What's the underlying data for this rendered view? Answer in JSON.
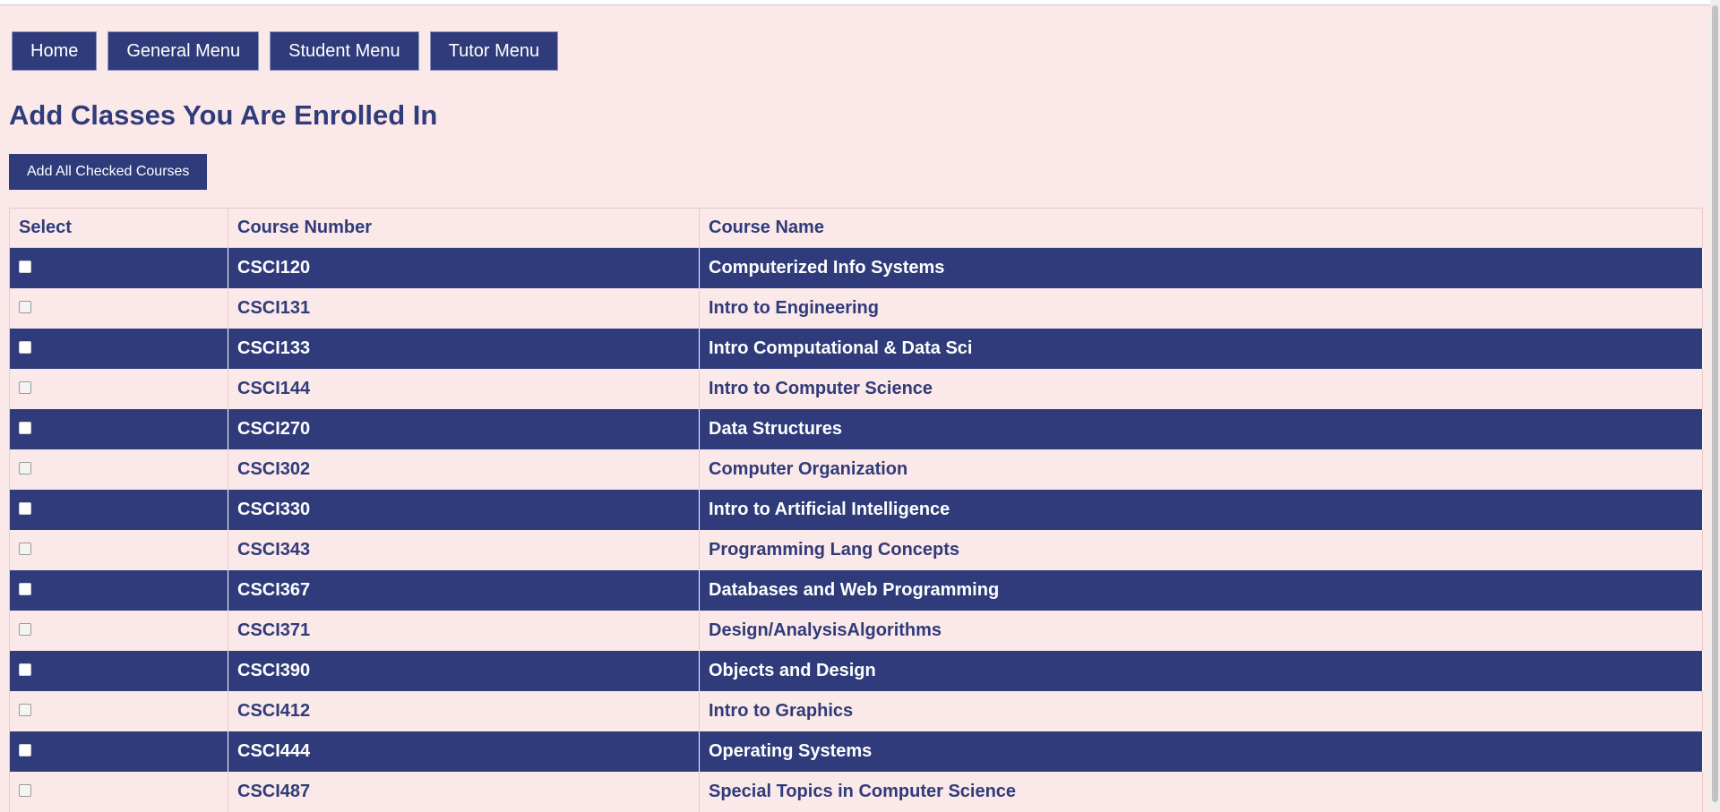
{
  "nav": [
    "Home",
    "General Menu",
    "Student Menu",
    "Tutor Menu"
  ],
  "page_title": "Add Classes You Are Enrolled In",
  "add_button": "Add All Checked Courses",
  "table": {
    "headers": [
      "Select",
      "Course Number",
      "Course Name"
    ],
    "rows": [
      {
        "number": "CSCI120",
        "name": "Computerized Info Systems",
        "checked": false
      },
      {
        "number": "CSCI131",
        "name": "Intro to Engineering",
        "checked": false
      },
      {
        "number": "CSCI133",
        "name": "Intro Computational & Data Sci",
        "checked": false
      },
      {
        "number": "CSCI144",
        "name": "Intro to Computer Science",
        "checked": false
      },
      {
        "number": "CSCI270",
        "name": "Data Structures",
        "checked": false
      },
      {
        "number": "CSCI302",
        "name": "Computer Organization",
        "checked": false
      },
      {
        "number": "CSCI330",
        "name": "Intro to Artificial Intelligence",
        "checked": false
      },
      {
        "number": "CSCI343",
        "name": "Programming Lang Concepts",
        "checked": false
      },
      {
        "number": "CSCI367",
        "name": "Databases and Web Programming",
        "checked": false
      },
      {
        "number": "CSCI371",
        "name": "Design/AnalysisAlgorithms",
        "checked": false
      },
      {
        "number": "CSCI390",
        "name": "Objects and Design",
        "checked": false
      },
      {
        "number": "CSCI412",
        "name": "Intro to Graphics",
        "checked": false
      },
      {
        "number": "CSCI444",
        "name": "Operating Systems",
        "checked": false
      },
      {
        "number": "CSCI487",
        "name": "Special Topics in Computer Science",
        "checked": false
      }
    ]
  },
  "colors": {
    "primary": "#2f3b7a",
    "background": "#fbe8e8"
  }
}
